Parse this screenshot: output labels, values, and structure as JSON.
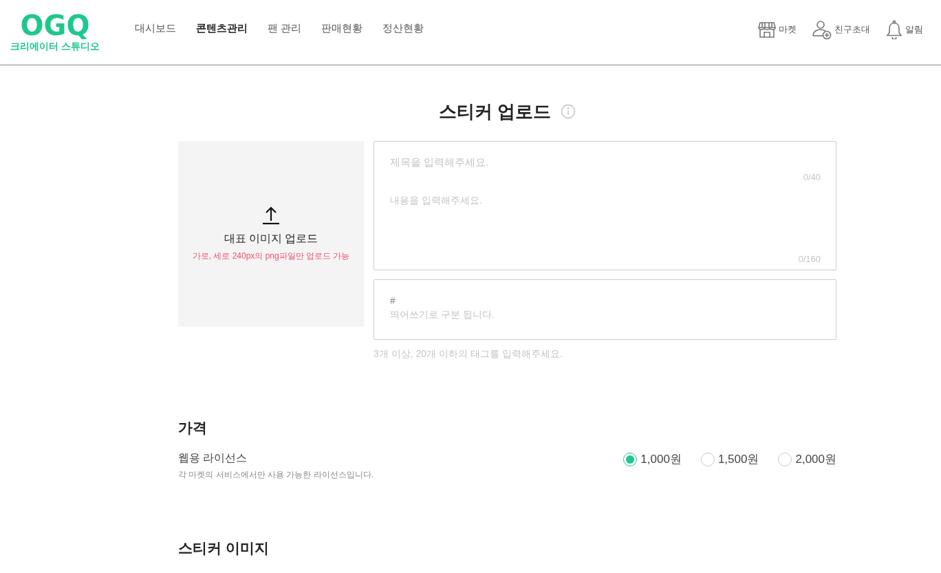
{
  "logo": {
    "mark": "OGQ",
    "subtitle": "크리에이터 스튜디오"
  },
  "nav": [
    {
      "label": "대시보드",
      "selected": false
    },
    {
      "label": "콘텐츠관리",
      "selected": true
    },
    {
      "label": "팬 관리",
      "selected": false
    },
    {
      "label": "판매현황",
      "selected": false
    },
    {
      "label": "정산현황",
      "selected": false
    }
  ],
  "header_actions": [
    {
      "kind": "store",
      "label": "마켓"
    },
    {
      "kind": "invite",
      "label": "친구초대"
    },
    {
      "kind": "bell",
      "label": "알림"
    }
  ],
  "page_title": "스티커 업로드",
  "image_upload": {
    "label": "대표 이미지 업로드",
    "hint": "가로, 세로 240px의 png파일만 업로드 가능"
  },
  "title_field": {
    "placeholder": "제목을 입력해주세요.",
    "counter": "0/40"
  },
  "content_field": {
    "placeholder": "내용을 입력해주세요.",
    "counter": "0/160"
  },
  "tags_field": {
    "prefix": "#",
    "placeholder": "띄어쓰기로 구분 됩니다."
  },
  "tags_hint": "3개 이상, 20개 이하의 태그를 입력해주세요.",
  "price": {
    "heading": "가격",
    "license": "웹용 라이선스",
    "description": "각 마켓의 서비스에서만 사용 가능한 라이선스입니다.",
    "options": [
      {
        "label": "1,000원",
        "selected": true
      },
      {
        "label": "1,500원",
        "selected": false
      },
      {
        "label": "2,000원",
        "selected": false
      }
    ]
  },
  "sticker_images": {
    "heading": "스티커 이미지"
  }
}
